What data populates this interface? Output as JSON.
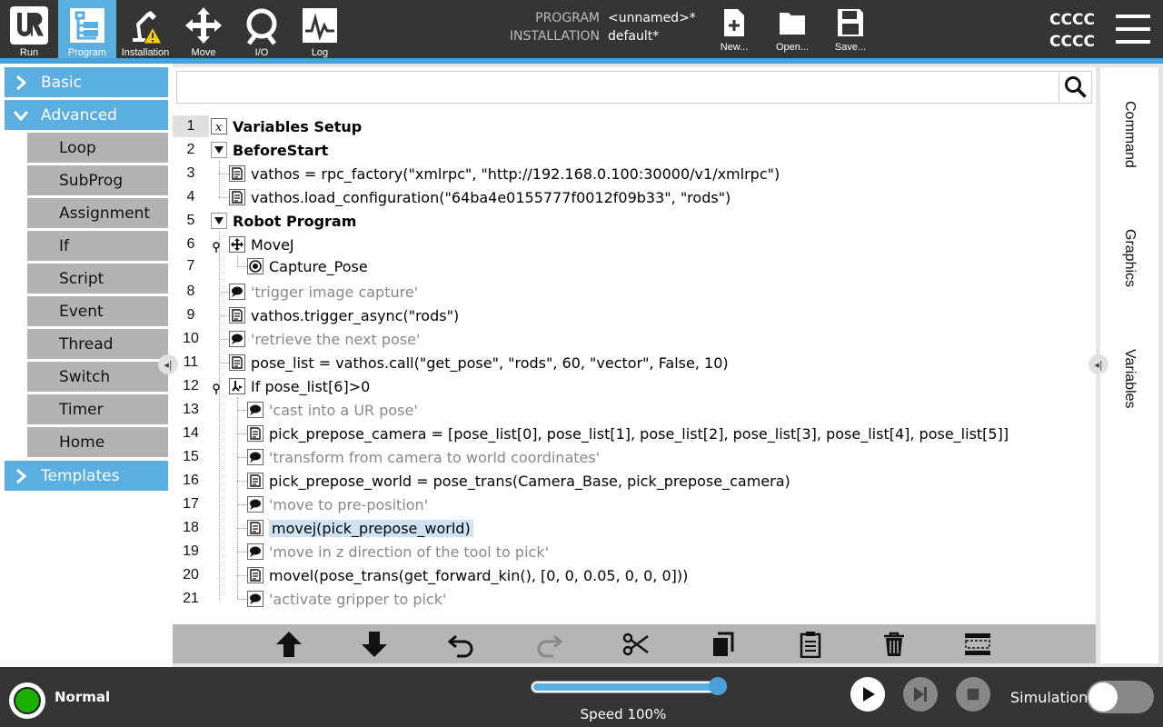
{
  "nav": {
    "run": "Run",
    "program": "Program",
    "installation": "Installation",
    "move": "Move",
    "io": "I/O",
    "log": "Log"
  },
  "program_info": {
    "program_label": "PROGRAM",
    "program_value": "<unnamed>*",
    "installation_label": "INSTALLATION",
    "installation_value": "default*"
  },
  "file_buttons": {
    "new": "New...",
    "open": "Open...",
    "save": "Save..."
  },
  "header_right": {
    "line1": "CCCC",
    "line2": "CCCC"
  },
  "sidebar": {
    "basic": "Basic",
    "advanced": "Advanced",
    "templates": "Templates",
    "advanced_items": [
      "Loop",
      "SubProg",
      "Assignment",
      "If",
      "Script",
      "Event",
      "Thread",
      "Switch",
      "Timer",
      "Home"
    ]
  },
  "search": {
    "placeholder": ""
  },
  "program_tree": [
    {
      "n": "1",
      "text": "Variables Setup",
      "icon": "variable-icon"
    },
    {
      "n": "2",
      "text": "BeforeStart",
      "icon": "collapse-triangle-icon"
    },
    {
      "n": "3",
      "text": "vathos = rpc_factory(\"xmlrpc\", \"http://192.168.0.100:30000/v1/xmlrpc\")",
      "icon": "script-icon"
    },
    {
      "n": "4",
      "text": "vathos.load_configuration(\"64ba4e0155777f0012f09b33\", \"rods\")",
      "icon": "script-icon"
    },
    {
      "n": "5",
      "text": "Robot Program",
      "icon": "collapse-triangle-icon"
    },
    {
      "n": "6",
      "text": "MoveJ",
      "icon": "move-icon"
    },
    {
      "n": "7",
      "text": "Capture_Pose",
      "icon": "waypoint-icon"
    },
    {
      "n": "8",
      "text": "'trigger image capture'",
      "icon": "comment-icon"
    },
    {
      "n": "9",
      "text": "vathos.trigger_async(\"rods\")",
      "icon": "script-icon"
    },
    {
      "n": "10",
      "text": "'retrieve the next pose'",
      "icon": "comment-icon"
    },
    {
      "n": "11",
      "text": "pose_list = vathos.call(\"get_pose\", \"rods\", 60, \"vector\", False, 10)",
      "icon": "script-icon"
    },
    {
      "n": "12",
      "text": "If pose_list[6]>0",
      "icon": "if-icon"
    },
    {
      "n": "13",
      "text": "'cast into a UR pose'",
      "icon": "comment-icon"
    },
    {
      "n": "14",
      "text": "pick_prepose_camera = [pose_list[0], pose_list[1], pose_list[2], pose_list[3], pose_list[4], pose_list[5]]",
      "icon": "script-icon"
    },
    {
      "n": "15",
      "text": "'transform from camera to world coordinates'",
      "icon": "comment-icon"
    },
    {
      "n": "16",
      "text": "pick_prepose_world = pose_trans(Camera_Base, pick_prepose_camera)",
      "icon": "script-icon"
    },
    {
      "n": "17",
      "text": "'move to pre-position'",
      "icon": "comment-icon"
    },
    {
      "n": "18",
      "text": "movej(pick_prepose_world)",
      "icon": "script-icon"
    },
    {
      "n": "19",
      "text": "'move in z direction of the tool to pick'",
      "icon": "comment-icon"
    },
    {
      "n": "20",
      "text": "movel(pose_trans(get_forward_kin(), [0, 0, 0.05, 0, 0, 0]))",
      "icon": "script-icon"
    },
    {
      "n": "21",
      "text": "'activate gripper to pick'",
      "icon": "comment-icon"
    }
  ],
  "right_tabs": {
    "command": "Command",
    "graphics": "Graphics",
    "variables": "Variables"
  },
  "footer": {
    "status": "Normal",
    "status_color": "#19b000",
    "speed_label": "Speed 100%",
    "speed_fraction": 1.0,
    "simulation_label": "Simulation",
    "simulation_on": false
  },
  "colors": {
    "accent": "#5aaee0",
    "header_bg": "#353535",
    "selection": "#cfe3f4"
  }
}
